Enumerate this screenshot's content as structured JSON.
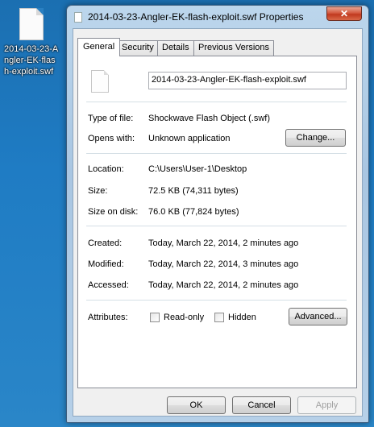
{
  "desktop": {
    "file_label_lines": [
      "2014-03-23-A",
      "ngler-EK-flas",
      "h-exploit.swf"
    ]
  },
  "window": {
    "title": "2014-03-23-Angler-EK-flash-exploit.swf Properties",
    "close_glyph": "✕"
  },
  "tabs": [
    "General",
    "Security",
    "Details",
    "Previous Versions"
  ],
  "general": {
    "filename": "2014-03-23-Angler-EK-flash-exploit.swf",
    "type_label": "Type of file:",
    "type_value": "Shockwave Flash Object (.swf)",
    "opens_label": "Opens with:",
    "opens_value": "Unknown application",
    "change_button": "Change...",
    "location_label": "Location:",
    "location_value": "C:\\Users\\User-1\\Desktop",
    "size_label": "Size:",
    "size_value": "72.5 KB (74,311 bytes)",
    "size_disk_label": "Size on disk:",
    "size_disk_value": "76.0 KB (77,824 bytes)",
    "created_label": "Created:",
    "created_value": "Today, March 22, 2014, 2 minutes ago",
    "modified_label": "Modified:",
    "modified_value": "Today, March 22, 2014, 3 minutes ago",
    "accessed_label": "Accessed:",
    "accessed_value": "Today, March 22, 2014, 2 minutes ago",
    "attributes_label": "Attributes:",
    "readonly_label": "Read-only",
    "hidden_label": "Hidden",
    "advanced_button": "Advanced..."
  },
  "footer": {
    "ok": "OK",
    "cancel": "Cancel",
    "apply": "Apply"
  }
}
